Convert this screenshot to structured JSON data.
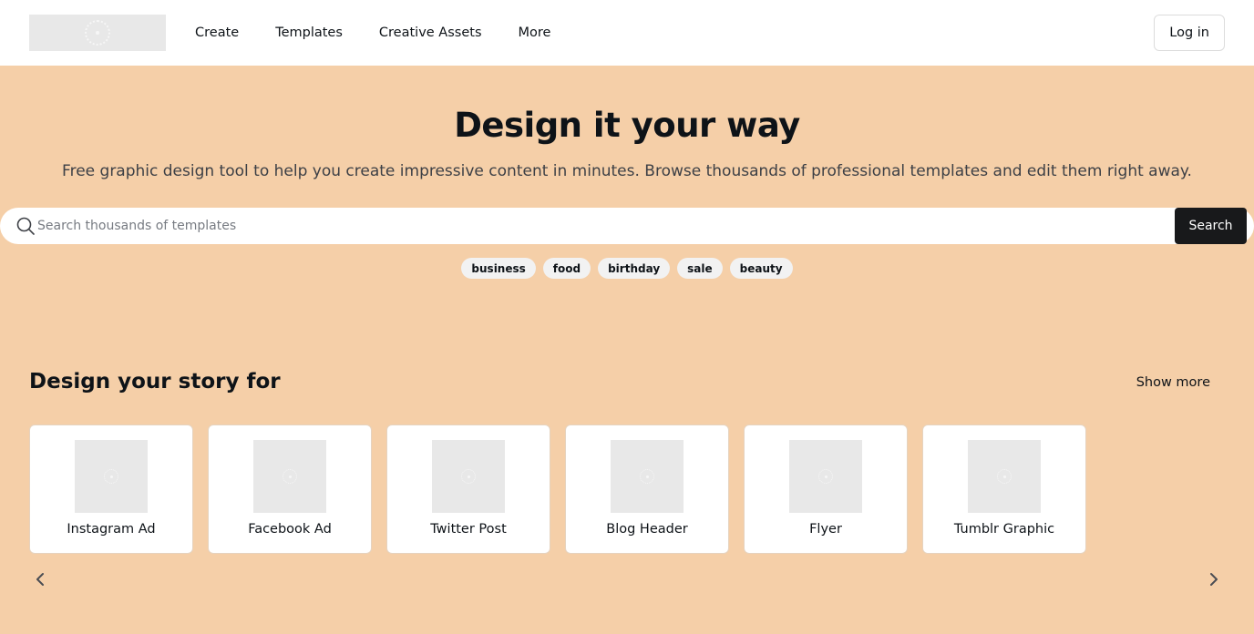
{
  "nav": {
    "items": [
      "Create",
      "Templates",
      "Creative Assets",
      "More"
    ],
    "login_label": "Log in"
  },
  "hero": {
    "title": "Design it your way",
    "subtitle": "Free graphic design tool to help you create impressive content in minutes. Browse thousands of professional templates and edit them right away."
  },
  "search": {
    "placeholder": "Search thousands of templates",
    "value": "",
    "button_label": "Search"
  },
  "tags": [
    "business",
    "food",
    "birthday",
    "sale",
    "beauty"
  ],
  "section": {
    "title": "Design your story for",
    "show_more_label": "Show more",
    "cards": [
      {
        "label": "Instagram Ad"
      },
      {
        "label": "Facebook Ad"
      },
      {
        "label": "Twitter Post"
      },
      {
        "label": "Blog Header"
      },
      {
        "label": "Flyer"
      },
      {
        "label": "Tumblr Graphic"
      }
    ]
  },
  "icons": {
    "search": "search-icon",
    "prev": "chevron-left-icon",
    "next": "chevron-right-icon"
  },
  "colors": {
    "background": "#f5cfa8",
    "header": "#ffffff",
    "primary_button": "#18191b",
    "tag_bg": "#f2f2f2",
    "placeholder": "#e8e8e8"
  }
}
